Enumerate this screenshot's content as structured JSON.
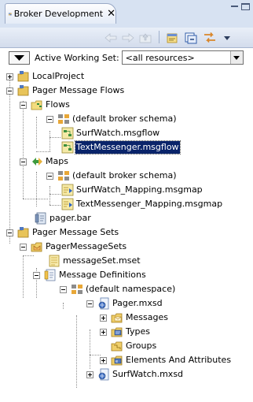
{
  "view": {
    "tab_title": "Broker Development",
    "tab_close": "✕"
  },
  "working_set": {
    "label": "Active Working Set:",
    "value": "<all resources>"
  },
  "tree": {
    "local_project": "LocalProject",
    "pager_message_flows": "Pager Message Flows",
    "flows": "Flows",
    "flows_default_schema": "(default broker schema)",
    "surfwatch_msgflow": "SurfWatch.msgflow",
    "textmessenger_msgflow": "TextMessenger.msgflow",
    "maps": "Maps",
    "maps_default_schema": "(default broker schema)",
    "surfwatch_mapping": "SurfWatch_Mapping.msgmap",
    "textmessenger_mapping": "TextMessenger_Mapping.msgmap",
    "pager_bar": "pager.bar",
    "pager_message_sets": "Pager Message Sets",
    "pager_message_sets_folder": "PagerMessageSets",
    "messageset_mset": "messageSet.mset",
    "message_definitions": "Message Definitions",
    "default_namespace": "(default namespace)",
    "pager_mxsd": "Pager.mxsd",
    "messages": "Messages",
    "types": "Types",
    "groups": "Groups",
    "elements_and_attributes": "Elements And Attributes",
    "surfwatch_mxsd": "SurfWatch.mxsd"
  },
  "icons": {
    "tab": "broker-view-icon",
    "back": "back-arrow-icon",
    "forward": "forward-arrow-icon",
    "up": "up-folder-icon",
    "new": "new-wizard-icon",
    "collapse": "collapse-all-icon",
    "link": "link-with-editor-icon",
    "menu": "view-menu-icon"
  },
  "colors": {
    "selection": "#0a246a",
    "tab_bar": "#d7e2f2",
    "project_folder": "#e8c45a"
  }
}
